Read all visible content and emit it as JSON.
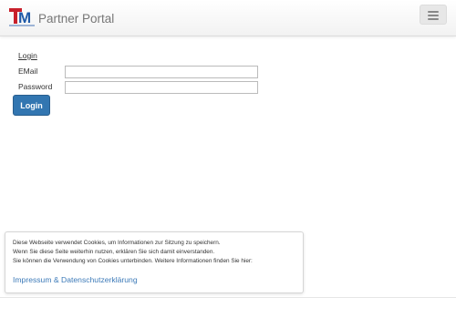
{
  "header": {
    "logo_text": "TM",
    "title": "Partner Portal",
    "menu_toggle_icon": "hamburger-menu-icon"
  },
  "login": {
    "heading": "Login",
    "email_label": "EMail",
    "email_value": "",
    "password_label": "Password",
    "password_value": "",
    "submit_label": "Login"
  },
  "cookie_notice": {
    "lines": [
      "Diese Webseite verwendet Cookies, um Informationen zur Sitzung zu speichern.",
      "Wenn Sie diese Seite weiterhin nutzen, erklären Sie sich damit einverstanden.",
      "Sie können die Verwendung von Cookies unterbinden. Weitere Informationen finden Sie hier:"
    ],
    "link_label": "Impressum & Datenschutzerklärung"
  },
  "colors": {
    "primary_button": "#3276b1",
    "link": "#3c7ab8",
    "logo_red": "#c8202b",
    "logo_blue": "#1f5aa8"
  }
}
